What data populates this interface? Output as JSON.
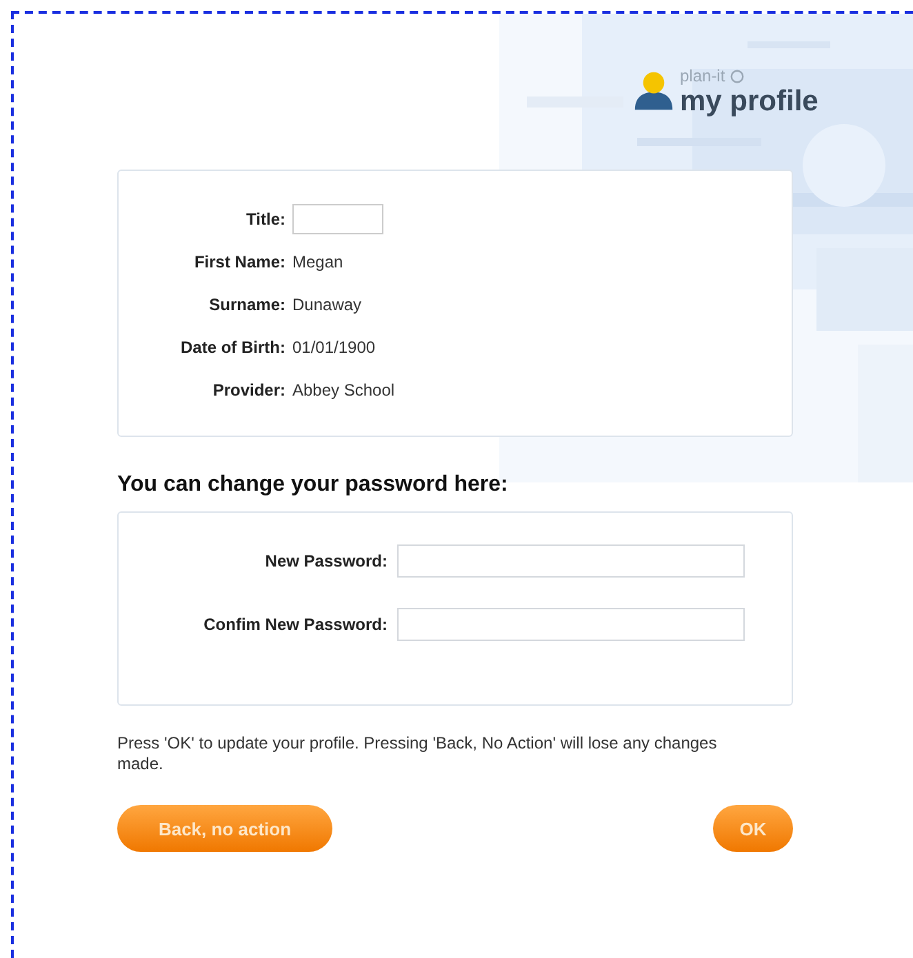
{
  "logo": {
    "brand": "plan-it",
    "title": "my profile"
  },
  "profile": [
    {
      "kind": "field",
      "label": "Title:"
    },
    {
      "kind": "text",
      "label": "First Name:",
      "value": "Megan"
    },
    {
      "kind": "text",
      "label": "Surname:",
      "value": "Dunaway"
    },
    {
      "kind": "text",
      "label": "Date of Birth:",
      "value": "01/01/1900"
    },
    {
      "kind": "text",
      "label": "Provider:",
      "value": "Abbey School"
    }
  ],
  "password": {
    "heading": "You can change your password here:",
    "fields": [
      {
        "label": "New Password:"
      },
      {
        "label": "Confim New Password:"
      }
    ]
  },
  "note": "Press 'OK' to update your profile. Pressing 'Back, No Action' will lose any changes made.",
  "buttons": [
    {
      "label": "Back, no action"
    },
    {
      "label": "OK"
    }
  ]
}
